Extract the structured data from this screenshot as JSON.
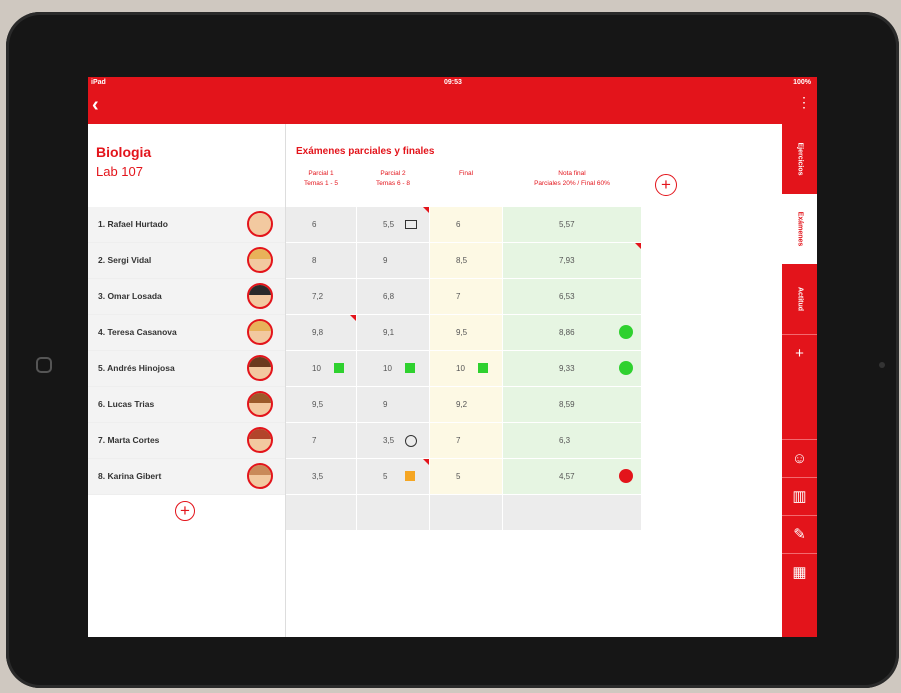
{
  "status": {
    "carrier": "iPad",
    "time": "09:53",
    "battery": "100%"
  },
  "nav": {
    "back_icon": "chevron-left-icon",
    "menu_icon": "more-vertical-icon"
  },
  "class_info": {
    "subject": "Biologia",
    "lab": "Lab 107"
  },
  "students": [
    {
      "name": "1. Rafael Hurtado",
      "hair": "#f2c9a0"
    },
    {
      "name": "2. Sergi Vidal",
      "hair": "#e8b25a"
    },
    {
      "name": "3. Omar Losada",
      "hair": "#2a2a2a"
    },
    {
      "name": "4. Teresa Casanova",
      "hair": "#e8b25a"
    },
    {
      "name": "5. Andrés Hinojosa",
      "hair": "#6b3a1e"
    },
    {
      "name": "6. Lucas Trias",
      "hair": "#9b5a2a"
    },
    {
      "name": "7. Marta Cortes",
      "hair": "#b2452a"
    },
    {
      "name": "8. Karina Gibert",
      "hair": "#c98a5a"
    }
  ],
  "section": {
    "title": "Exámenes parciales y finales"
  },
  "columns": [
    {
      "label": "Parcial 1",
      "sub": "Temas 1 - 5"
    },
    {
      "label": "Parcial 2",
      "sub": "Temas 6 - 8"
    },
    {
      "label": "Final",
      "sub": ""
    },
    {
      "label": "Nota final",
      "sub": "Parciales 20% / Final 60%"
    }
  ],
  "grades": [
    {
      "p1": "6",
      "p2": "5,5",
      "fin": "6",
      "nota": "5,57",
      "p2_icon": "mail-icon",
      "p2_mark": true
    },
    {
      "p1": "8",
      "p2": "9",
      "fin": "8,5",
      "nota": "7,93",
      "nota_mark": true
    },
    {
      "p1": "7,2",
      "p2": "6,8",
      "fin": "7",
      "nota": "6,53"
    },
    {
      "p1": "9,8",
      "p2": "9,1",
      "fin": "9,5",
      "nota": "8,86",
      "p1_mark": true,
      "dot": "green"
    },
    {
      "p1": "10",
      "p2": "10",
      "fin": "10",
      "nota": "9,33",
      "flags": true,
      "dot": "green"
    },
    {
      "p1": "9,5",
      "p2": "9",
      "fin": "9,2",
      "nota": "8,59"
    },
    {
      "p1": "7",
      "p2": "3,5",
      "fin": "7",
      "nota": "6,3",
      "p2_icon": "sad-face-icon"
    },
    {
      "p1": "3,5",
      "p2": "5",
      "fin": "5",
      "nota": "4,57",
      "p2_flag": "orange",
      "p2_mark": true,
      "dot": "red"
    }
  ],
  "colors": {
    "accent": "#e3141b",
    "green": "#2fd12f",
    "red": "#e3141b",
    "orange": "#f5a623"
  },
  "side_tabs": [
    {
      "label": "Ejercicios"
    },
    {
      "label": "Exámenes",
      "active": true
    },
    {
      "label": "Actitud"
    }
  ],
  "side_icons": [
    "plus-icon",
    "user-icon",
    "book-icon",
    "pencil-icon",
    "calculator-icon"
  ]
}
